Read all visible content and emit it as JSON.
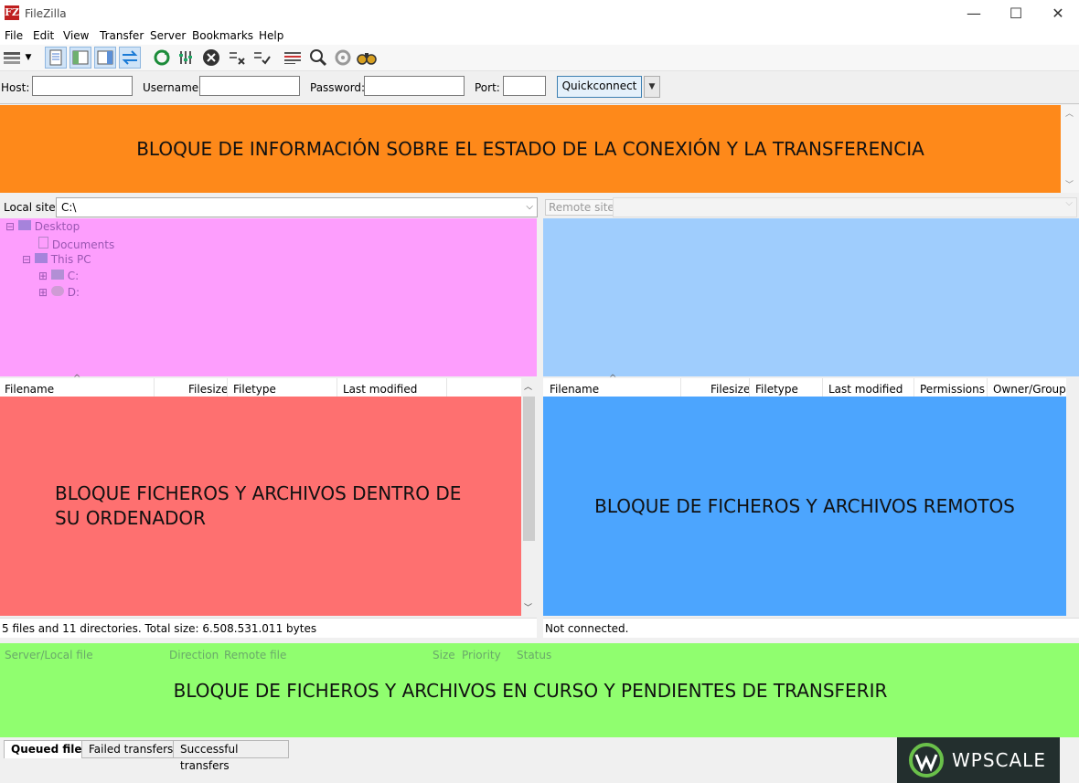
{
  "window": {
    "title": "FileZilla",
    "icon_glyph": "FZ",
    "min": "—",
    "max": "☐",
    "close": "✕"
  },
  "menu": [
    "File",
    "Edit",
    "View",
    "Transfer",
    "Server",
    "Bookmarks",
    "Help"
  ],
  "toolbar": {
    "icons": [
      "site-manager-icon",
      "dropdown-arrow-icon",
      "toggle-message-log-icon",
      "toggle-local-tree-icon",
      "toggle-remote-tree-icon",
      "toggle-queue-icon",
      "refresh-icon",
      "process-queue-icon",
      "cancel-icon",
      "disconnect-icon",
      "reconnect-icon",
      "filter-icon",
      "compare-icon",
      "sync-browse-icon",
      "search-icon"
    ]
  },
  "quickconnect": {
    "host_label": "Host:",
    "username_label": "Username:",
    "password_label": "Password:",
    "port_label": "Port:",
    "host_value": "",
    "username_value": "",
    "password_value": "",
    "port_value": "",
    "button": "Quickconnect"
  },
  "status_block": {
    "text": "BLOQUE DE INFORMACIÓN SOBRE EL ESTADO DE LA CONEXIÓN Y LA TRANSFERENCIA"
  },
  "local": {
    "label": "Local site:",
    "path": "C:\\",
    "tree": [
      {
        "label": "Desktop",
        "expander": "⊟"
      },
      {
        "label": "Documents",
        "expander": ""
      },
      {
        "label": "This PC",
        "expander": "⊟"
      },
      {
        "label": "C:",
        "expander": "⊞"
      },
      {
        "label": "D:",
        "expander": "⊞"
      }
    ],
    "columns": [
      "Filename",
      "Filesize",
      "Filetype",
      "Last modified"
    ],
    "files_block_text": "BLOQUE FICHEROS Y ARCHIVOS DENTRO DE SU ORDENADOR",
    "status": "5 files and 11 directories. Total size: 6.508.531.011 bytes"
  },
  "remote": {
    "label": "Remote site:",
    "path": "",
    "columns": [
      "Filename",
      "Filesize",
      "Filetype",
      "Last modified",
      "Permissions",
      "Owner/Group"
    ],
    "files_block_text": "BLOQUE DE FICHEROS Y ARCHIVOS REMOTOS",
    "status": "Not connected."
  },
  "queue": {
    "columns": [
      "Server/Local file",
      "Direction",
      "Remote file",
      "Size",
      "Priority",
      "Status"
    ],
    "block_text": "BLOQUE DE FICHEROS Y ARCHIVOS EN CURSO Y PENDIENTES DE TRANSFERIR",
    "tabs": [
      "Queued files",
      "Failed transfers",
      "Successful transfers"
    ]
  },
  "watermark": {
    "text": "WPSCALE"
  }
}
